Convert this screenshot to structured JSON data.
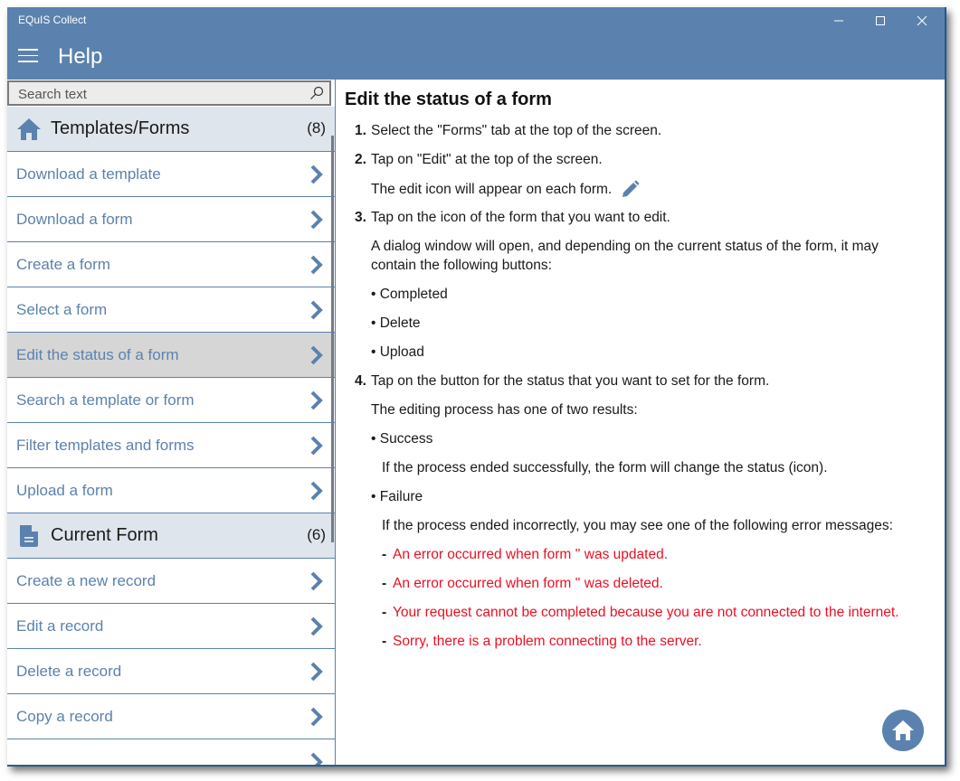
{
  "window": {
    "app_title": "EQuIS Collect",
    "controls": {
      "minimize": "minimize-icon",
      "maximize": "maximize-icon",
      "close": "close-icon"
    }
  },
  "header": {
    "menu_icon": "hamburger-icon",
    "title": "Help"
  },
  "search": {
    "placeholder": "Search text",
    "value": "",
    "icon": "search-icon"
  },
  "sidebar": {
    "groups": [
      {
        "title": "Templates/Forms",
        "count": "(8)",
        "icon": "home-icon",
        "items": [
          {
            "label": "Download a template",
            "selected": false
          },
          {
            "label": "Download a form",
            "selected": false
          },
          {
            "label": "Create a form",
            "selected": false
          },
          {
            "label": "Select a form",
            "selected": false
          },
          {
            "label": "Edit the status of a form",
            "selected": true
          },
          {
            "label": "Search a template or form",
            "selected": false
          },
          {
            "label": "Filter templates and forms",
            "selected": false
          },
          {
            "label": "Upload a form",
            "selected": false
          }
        ]
      },
      {
        "title": "Current Form",
        "count": "(6)",
        "icon": "document-icon",
        "items": [
          {
            "label": "Create a new record",
            "selected": false
          },
          {
            "label": "Edit a record",
            "selected": false
          },
          {
            "label": "Delete a record",
            "selected": false
          },
          {
            "label": "Copy a record",
            "selected": false
          }
        ]
      }
    ]
  },
  "content": {
    "title": "Edit the status of a form",
    "steps": [
      {
        "num": "1.",
        "text": "Select the \"Forms\" tab at the top of the screen."
      },
      {
        "num": "2.",
        "text": "Tap on \"Edit\" at the top of the screen.",
        "note": "The edit icon will appear on each form."
      },
      {
        "num": "3.",
        "text": "Tap on the icon of the form that you want to edit.",
        "note_line1": "A dialog window will open, and depending on the current status of the form, it may",
        "note_line2": "contain the following buttons:",
        "bullets": [
          "Completed",
          "Delete",
          "Upload"
        ]
      },
      {
        "num": "4.",
        "text": "Tap on the button for the status that you want to set for the form.",
        "note": "The editing process has one of two results:",
        "results": [
          {
            "label": "Success",
            "note": "If the process ended successfully, the form will change the status (icon)."
          },
          {
            "label": "Failure",
            "note": "If the process ended incorrectly, you may see one of the following error messages:"
          }
        ],
        "errors": [
          "An error occurred when form '' was updated.",
          "An error occurred when form '' was deleted.",
          "Your request cannot be completed because you are not connected to the internet.",
          "Sorry, there is a problem connecting to the server."
        ]
      }
    ],
    "home_button_icon": "home-icon"
  },
  "colors": {
    "accent": "#5b82ae",
    "selected_bg": "#d6d6d6",
    "group_bg": "#dfe5ec",
    "error": "#e81123"
  }
}
